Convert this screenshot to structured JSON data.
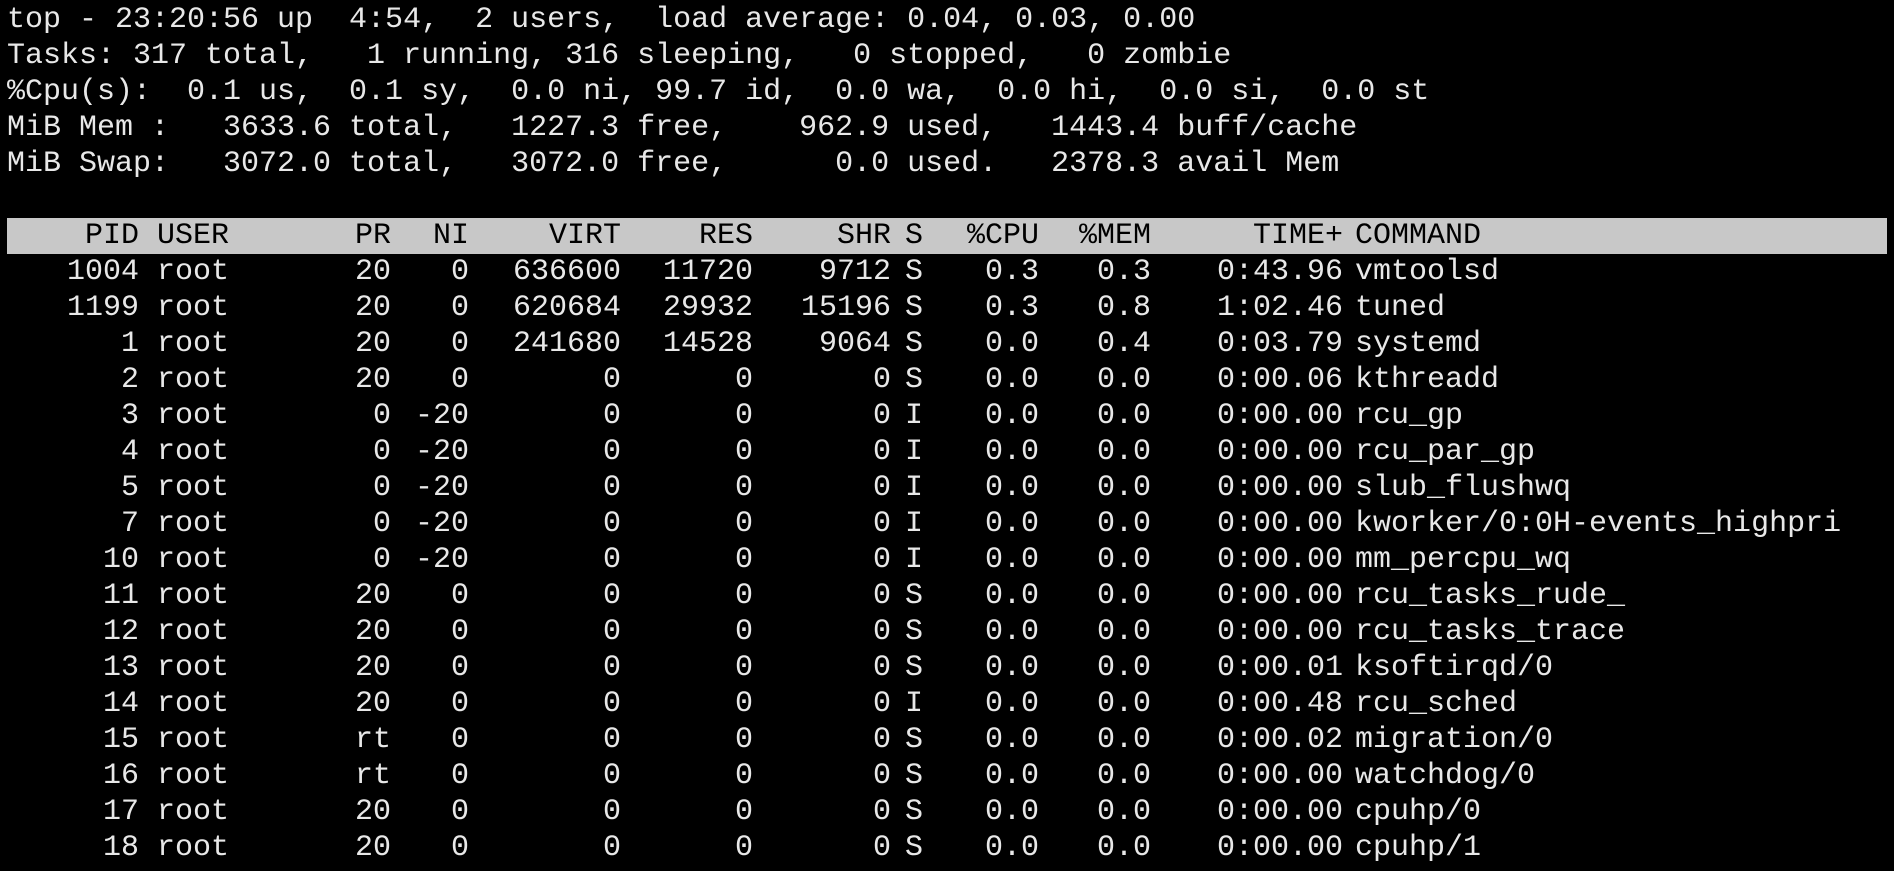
{
  "summary": {
    "line1": "top - 23:20:56 up  4:54,  2 users,  load average: 0.04, 0.03, 0.00",
    "line2": "Tasks: 317 total,   1 running, 316 sleeping,   0 stopped,   0 zombie",
    "line3": "%Cpu(s):  0.1 us,  0.1 sy,  0.0 ni, 99.7 id,  0.0 wa,  0.0 hi,  0.0 si,  0.0 st",
    "line4": "MiB Mem :   3633.6 total,   1227.3 free,    962.9 used,   1443.4 buff/cache",
    "line5": "MiB Swap:   3072.0 total,   3072.0 free,      0.0 used.   2378.3 avail Mem"
  },
  "columns": {
    "pid": "PID",
    "user": "USER",
    "pr": "PR",
    "ni": "NI",
    "virt": "VIRT",
    "res": "RES",
    "shr": "SHR",
    "s": "S",
    "cpu": "%CPU",
    "mem": "%MEM",
    "time": "TIME+",
    "command": "COMMAND"
  },
  "processes": [
    {
      "pid": "1004",
      "user": "root",
      "pr": "20",
      "ni": "0",
      "virt": "636600",
      "res": "11720",
      "shr": "9712",
      "s": "S",
      "cpu": "0.3",
      "mem": "0.3",
      "time": "0:43.96",
      "command": "vmtoolsd"
    },
    {
      "pid": "1199",
      "user": "root",
      "pr": "20",
      "ni": "0",
      "virt": "620684",
      "res": "29932",
      "shr": "15196",
      "s": "S",
      "cpu": "0.3",
      "mem": "0.8",
      "time": "1:02.46",
      "command": "tuned"
    },
    {
      "pid": "1",
      "user": "root",
      "pr": "20",
      "ni": "0",
      "virt": "241680",
      "res": "14528",
      "shr": "9064",
      "s": "S",
      "cpu": "0.0",
      "mem": "0.4",
      "time": "0:03.79",
      "command": "systemd"
    },
    {
      "pid": "2",
      "user": "root",
      "pr": "20",
      "ni": "0",
      "virt": "0",
      "res": "0",
      "shr": "0",
      "s": "S",
      "cpu": "0.0",
      "mem": "0.0",
      "time": "0:00.06",
      "command": "kthreadd"
    },
    {
      "pid": "3",
      "user": "root",
      "pr": "0",
      "ni": "-20",
      "virt": "0",
      "res": "0",
      "shr": "0",
      "s": "I",
      "cpu": "0.0",
      "mem": "0.0",
      "time": "0:00.00",
      "command": "rcu_gp"
    },
    {
      "pid": "4",
      "user": "root",
      "pr": "0",
      "ni": "-20",
      "virt": "0",
      "res": "0",
      "shr": "0",
      "s": "I",
      "cpu": "0.0",
      "mem": "0.0",
      "time": "0:00.00",
      "command": "rcu_par_gp"
    },
    {
      "pid": "5",
      "user": "root",
      "pr": "0",
      "ni": "-20",
      "virt": "0",
      "res": "0",
      "shr": "0",
      "s": "I",
      "cpu": "0.0",
      "mem": "0.0",
      "time": "0:00.00",
      "command": "slub_flushwq"
    },
    {
      "pid": "7",
      "user": "root",
      "pr": "0",
      "ni": "-20",
      "virt": "0",
      "res": "0",
      "shr": "0",
      "s": "I",
      "cpu": "0.0",
      "mem": "0.0",
      "time": "0:00.00",
      "command": "kworker/0:0H-events_highpri"
    },
    {
      "pid": "10",
      "user": "root",
      "pr": "0",
      "ni": "-20",
      "virt": "0",
      "res": "0",
      "shr": "0",
      "s": "I",
      "cpu": "0.0",
      "mem": "0.0",
      "time": "0:00.00",
      "command": "mm_percpu_wq"
    },
    {
      "pid": "11",
      "user": "root",
      "pr": "20",
      "ni": "0",
      "virt": "0",
      "res": "0",
      "shr": "0",
      "s": "S",
      "cpu": "0.0",
      "mem": "0.0",
      "time": "0:00.00",
      "command": "rcu_tasks_rude_"
    },
    {
      "pid": "12",
      "user": "root",
      "pr": "20",
      "ni": "0",
      "virt": "0",
      "res": "0",
      "shr": "0",
      "s": "S",
      "cpu": "0.0",
      "mem": "0.0",
      "time": "0:00.00",
      "command": "rcu_tasks_trace"
    },
    {
      "pid": "13",
      "user": "root",
      "pr": "20",
      "ni": "0",
      "virt": "0",
      "res": "0",
      "shr": "0",
      "s": "S",
      "cpu": "0.0",
      "mem": "0.0",
      "time": "0:00.01",
      "command": "ksoftirqd/0"
    },
    {
      "pid": "14",
      "user": "root",
      "pr": "20",
      "ni": "0",
      "virt": "0",
      "res": "0",
      "shr": "0",
      "s": "I",
      "cpu": "0.0",
      "mem": "0.0",
      "time": "0:00.48",
      "command": "rcu_sched"
    },
    {
      "pid": "15",
      "user": "root",
      "pr": "rt",
      "ni": "0",
      "virt": "0",
      "res": "0",
      "shr": "0",
      "s": "S",
      "cpu": "0.0",
      "mem": "0.0",
      "time": "0:00.02",
      "command": "migration/0"
    },
    {
      "pid": "16",
      "user": "root",
      "pr": "rt",
      "ni": "0",
      "virt": "0",
      "res": "0",
      "shr": "0",
      "s": "S",
      "cpu": "0.0",
      "mem": "0.0",
      "time": "0:00.00",
      "command": "watchdog/0"
    },
    {
      "pid": "17",
      "user": "root",
      "pr": "20",
      "ni": "0",
      "virt": "0",
      "res": "0",
      "shr": "0",
      "s": "S",
      "cpu": "0.0",
      "mem": "0.0",
      "time": "0:00.00",
      "command": "cpuhp/0"
    },
    {
      "pid": "18",
      "user": "root",
      "pr": "20",
      "ni": "0",
      "virt": "0",
      "res": "0",
      "shr": "0",
      "s": "S",
      "cpu": "0.0",
      "mem": "0.0",
      "time": "0:00.00",
      "command": "cpuhp/1"
    }
  ],
  "colors": {
    "background": "#000000",
    "foreground": "#e8e8e8",
    "header_bg": "#c8c8c8",
    "header_fg": "#000000"
  }
}
